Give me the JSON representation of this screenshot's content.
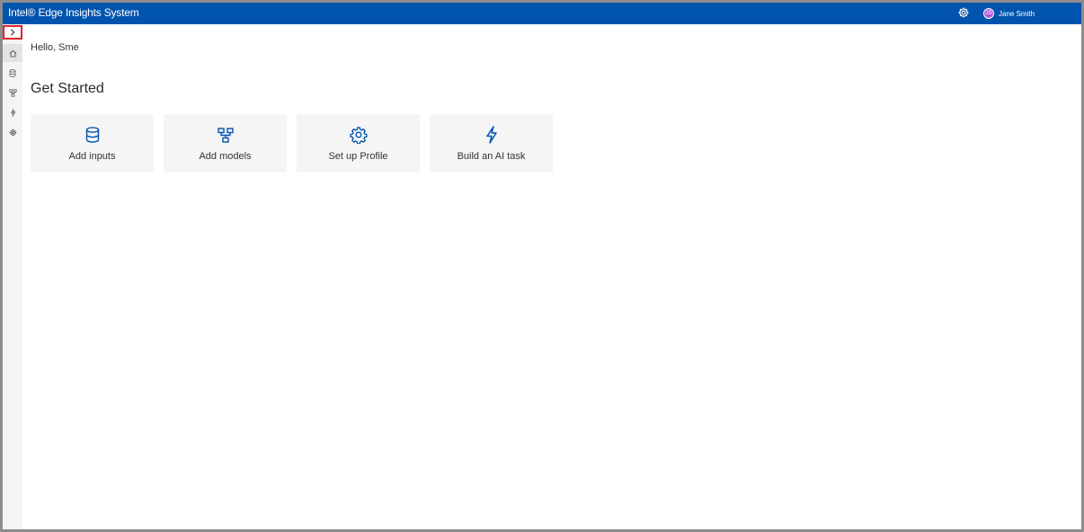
{
  "app": {
    "title": "Intel® Edge Insights System",
    "header_icons": {
      "settings": "gear-icon"
    },
    "user": {
      "initials": "JS",
      "name": "Jane Smith"
    }
  },
  "sidebar": {
    "expand_icon": "chevron-right-icon",
    "items": [
      {
        "icon": "home-icon",
        "active": true
      },
      {
        "icon": "database-icon",
        "active": false
      },
      {
        "icon": "models-icon",
        "active": false
      },
      {
        "icon": "lightning-icon",
        "active": false
      },
      {
        "icon": "gear-icon",
        "active": false
      }
    ]
  },
  "main": {
    "greeting": "Hello, Sme",
    "section_title": "Get Started",
    "cards": [
      {
        "label": "Add inputs",
        "icon": "database-icon"
      },
      {
        "label": "Add models",
        "icon": "models-icon"
      },
      {
        "label": "Set up Profile",
        "icon": "gear-icon"
      },
      {
        "label": "Build an AI task",
        "icon": "lightning-icon"
      }
    ]
  },
  "colors": {
    "header": "#0054ae",
    "accent": "#0054ae",
    "highlight": "#e0242b",
    "avatar": "#b35ad6",
    "card_bg": "#f5f5f5"
  }
}
